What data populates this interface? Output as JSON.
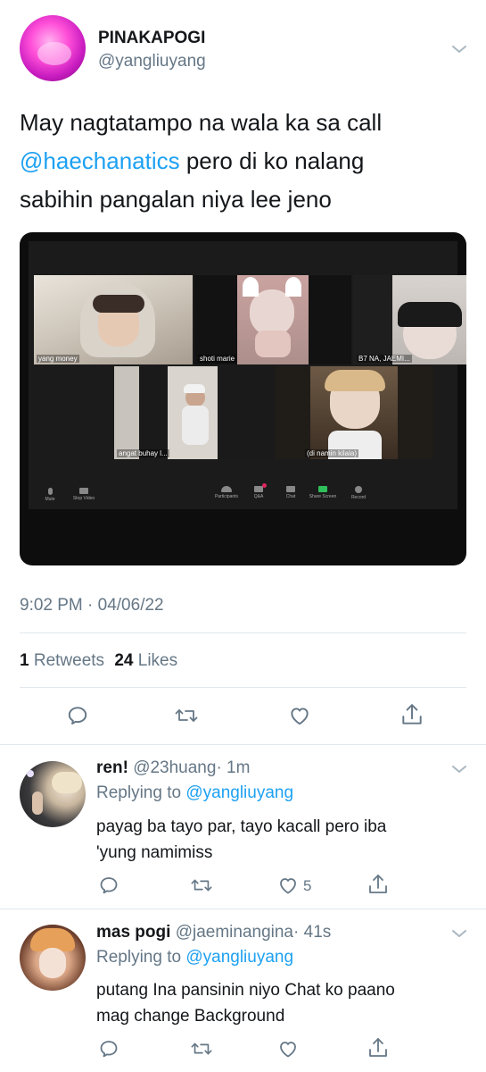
{
  "tweet": {
    "display_name": "PINAKAPOGI",
    "handle": "@yangliuyang",
    "text_line1": "May nagtatampo na wala ka sa call",
    "text_mention": "@haechanatics",
    "text_line2_rest": " pero di ko nalang",
    "text_line3": "sabihin pangalan niya lee jeno",
    "timestamp": "9:02 PM · 04/06/22",
    "retweets_count": "1",
    "retweets_label": "Retweets",
    "likes_count": "24",
    "likes_label": "Likes",
    "media": {
      "participants": [
        {
          "label": "yang money"
        },
        {
          "label": "shoti marie"
        },
        {
          "label": "B7 NA, JAEMI..."
        },
        {
          "label": "angat buhay l..."
        },
        {
          "label": "(di namin kilala)"
        }
      ],
      "toolbar": {
        "mute": "Mute",
        "stop_video": "Stop Video",
        "participants": "Participants",
        "qa": "Q&A",
        "chat": "Chat",
        "share_screen": "Share Screen",
        "record": "Record"
      }
    }
  },
  "replies": [
    {
      "display_name": "ren!",
      "handle": "@23huang",
      "time": "· 1m",
      "replying_prefix": "Replying to",
      "replying_to": "@yangliuyang",
      "text_line1": "payag ba tayo par, tayo kacall pero iba",
      "text_line2": "'yung namimiss",
      "like_count": "5"
    },
    {
      "display_name": "mas pogi",
      "handle": "@jaeminangina",
      "time": "· 41s",
      "replying_prefix": "Replying to",
      "replying_to": "@yangliuyang",
      "text_line1": "putang Ina pansinin niyo Chat ko paano",
      "text_line2": "mag change Background",
      "like_count": ""
    }
  ],
  "icons": {
    "reply": "reply-icon",
    "retweet": "retweet-icon",
    "like": "heart-icon",
    "share": "share-icon",
    "more": "chevron-down-icon"
  },
  "colors": {
    "link": "#1da1f2",
    "secondary_text": "#657786",
    "divider": "#e1e8ed"
  }
}
